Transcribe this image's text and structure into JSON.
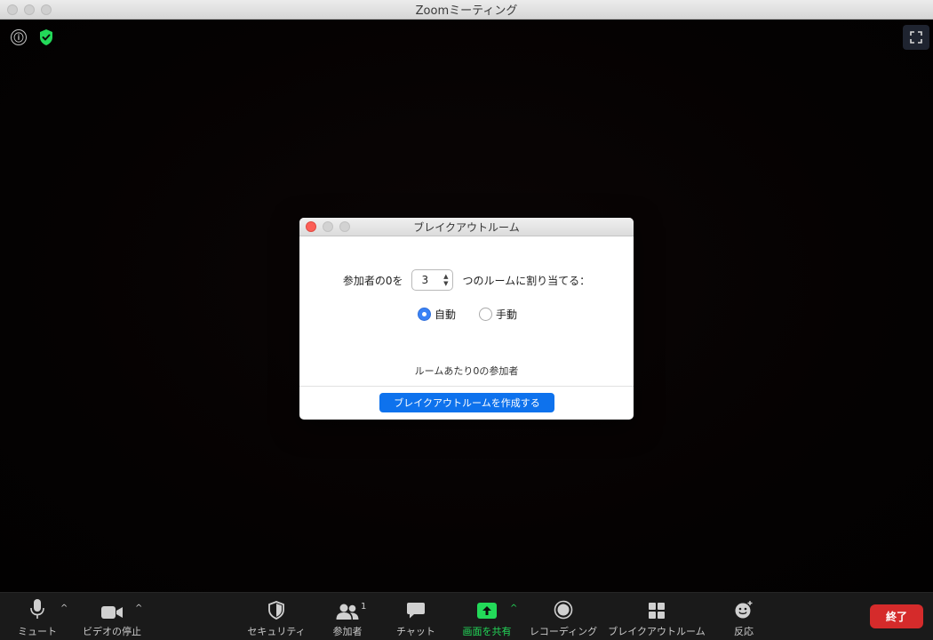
{
  "window": {
    "title": "Zoomミーティング"
  },
  "dialog": {
    "title": "ブレイクアウトルーム",
    "assign_prefix": "参加者の0を",
    "room_count": "3",
    "assign_suffix": "つのルームに割り当てる：",
    "mode_auto": "自動",
    "mode_manual": "手動",
    "selected_mode": "auto",
    "per_room_text": "ルームあたり0の参加者",
    "create_button": "ブレイクアウトルームを作成する"
  },
  "toolbar": {
    "mute": "ミュート",
    "stop_video": "ビデオの停止",
    "security": "セキュリティ",
    "participants": "参加者",
    "participants_count": "1",
    "chat": "チャット",
    "share_screen": "画面を共有",
    "recording": "レコーディング",
    "breakout_rooms": "ブレイクアウトルーム",
    "reactions": "反応",
    "end": "終了"
  },
  "colors": {
    "share_green": "#23d959",
    "end_red": "#d52b2b",
    "primary_blue": "#0e72ed",
    "shield_green": "#23d959",
    "close_red": "#fc5f57"
  },
  "icons": {
    "info": "ⓘ",
    "caret": "^"
  }
}
